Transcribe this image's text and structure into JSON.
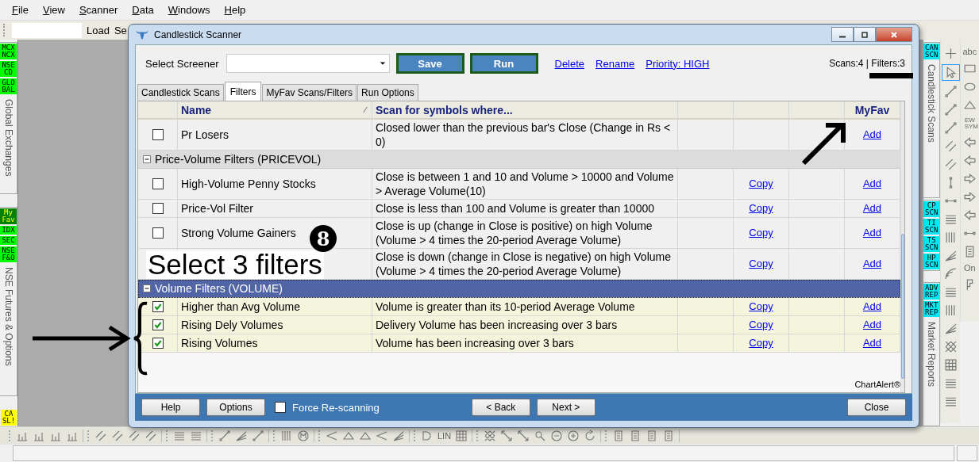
{
  "menu": [
    "File",
    "View",
    "Scanner",
    "Data",
    "Windows",
    "Help"
  ],
  "toolbar": {
    "buttons": [
      "Load",
      "Se"
    ]
  },
  "left_panel": {
    "sections": [
      {
        "tags": [
          {
            "label": "MCX NCX",
            "color": "#00ff00"
          },
          {
            "label": "NSE CD",
            "color": "#00ff00"
          },
          {
            "label": "GLOBAL",
            "color": "#00ff00"
          }
        ],
        "title": "Global Exchanges"
      },
      {
        "tags": [
          {
            "label": "My Fav",
            "color": "#008000"
          },
          {
            "label": "IDX",
            "color": "#00ff00"
          },
          {
            "label": "SEC",
            "color": "#00ff00"
          },
          {
            "label": "NSE F&O",
            "color": "#00ff00"
          }
        ],
        "title": "NSE Futures & Options"
      },
      {
        "tags": [
          {
            "label": "CA SL!",
            "color": "#ffff00"
          }
        ]
      }
    ]
  },
  "right_panel": {
    "sections": [
      {
        "tags": [
          {
            "label": "CAN SCN",
            "color": "#00e8f0"
          }
        ],
        "title": "Candlestick Scans"
      },
      {
        "tags": [
          {
            "label": "CP SCN",
            "color": "#00e8f0"
          },
          {
            "label": "TI SCN",
            "color": "#00e8f0"
          },
          {
            "label": "TS SCN",
            "color": "#00e8f0"
          },
          {
            "label": "HP SCN",
            "color": "#00e8f0"
          }
        ]
      },
      {
        "tags": [
          {
            "label": "ADV REP",
            "color": "#00e8f0"
          },
          {
            "label": "MKT REP",
            "color": "#00e8f0"
          }
        ],
        "title": "Market Reports"
      }
    ]
  },
  "drawing_tools": {
    "pointer_selected": true,
    "text_label": "abc",
    "wave_label": "EW SYM",
    "toggle_label": "On"
  },
  "bottom_toolbar": {
    "line_label": "LIN"
  },
  "dialog": {
    "title": "Candlestick Scanner",
    "screener_label": "Select Screener",
    "buttons": [
      "Save",
      "Run"
    ],
    "links": [
      "Delete",
      "Rename",
      "Priority: HIGH"
    ],
    "counts": "Scans:4 | Filters:3",
    "tabs": [
      {
        "label": "Candlestick Scans",
        "selected": false
      },
      {
        "label": "Filters",
        "selected": true
      },
      {
        "label": "MyFav Scans/Filters",
        "selected": false
      },
      {
        "label": "Run Options",
        "selected": false
      }
    ],
    "columns": [
      "Name",
      "Scan for symbols where...",
      "MyFav"
    ],
    "rows": [
      {
        "kind": "item",
        "checked": false,
        "name": "Pr Losers",
        "description": "Closed lower than the previous bar's Close (Change in Rs < 0)",
        "add": "Add"
      },
      {
        "kind": "group",
        "expanded": true,
        "selected": false,
        "label": "Price-Volume Filters (PRICEVOL)"
      },
      {
        "kind": "item",
        "checked": false,
        "name": "High-Volume Penny Stocks",
        "description": "Close is between 1 and 10 and Volume > 10000 and Volume > Average Volume(10)",
        "copy": "Copy",
        "add": "Add"
      },
      {
        "kind": "item",
        "checked": false,
        "name": "Price-Vol Filter",
        "description": "Close is less than 100 and Volume is greater than 10000",
        "copy": "Copy",
        "add": "Add"
      },
      {
        "kind": "item",
        "checked": false,
        "name": "Strong Volume Gainers",
        "description": "Close is up (change in Close is positive) on high Volume (Volume > 4 times the 20-period Average Volume)",
        "copy": "Copy",
        "add": "Add"
      },
      {
        "kind": "item",
        "description": "Close is down (change in Close is negative) on high Volume (Volume > 4 times the 20-period Average Volume)",
        "copy": "Copy",
        "add": "Add"
      },
      {
        "kind": "group",
        "expanded": true,
        "selected": true,
        "label": "Volume Filters (VOLUME)"
      },
      {
        "kind": "item",
        "checked": true,
        "name": "Higher than Avg Volume",
        "description": "Volume is greater than its 10-period Average Volume",
        "copy": "Copy",
        "add": "Add"
      },
      {
        "kind": "item",
        "checked": true,
        "name": "Rising Dely Volumes",
        "description": "Delivery Volume has been increasing over 3 bars",
        "copy": "Copy",
        "add": "Add"
      },
      {
        "kind": "item",
        "checked": true,
        "name": "Rising Volumes",
        "description": "Volume has been increasing over 3 bars",
        "copy": "Copy",
        "add": "Add"
      }
    ],
    "footer_mark": "ChartAlert®",
    "left_buttons": [
      "Help",
      "Options"
    ],
    "force_rescan": {
      "label": "Force Re-scanning",
      "checked": false
    },
    "nav_buttons": [
      "< Back",
      "Next >"
    ],
    "close_button": "Close"
  },
  "annotations": {
    "caption": "Select 3 filters",
    "step": "8"
  }
}
